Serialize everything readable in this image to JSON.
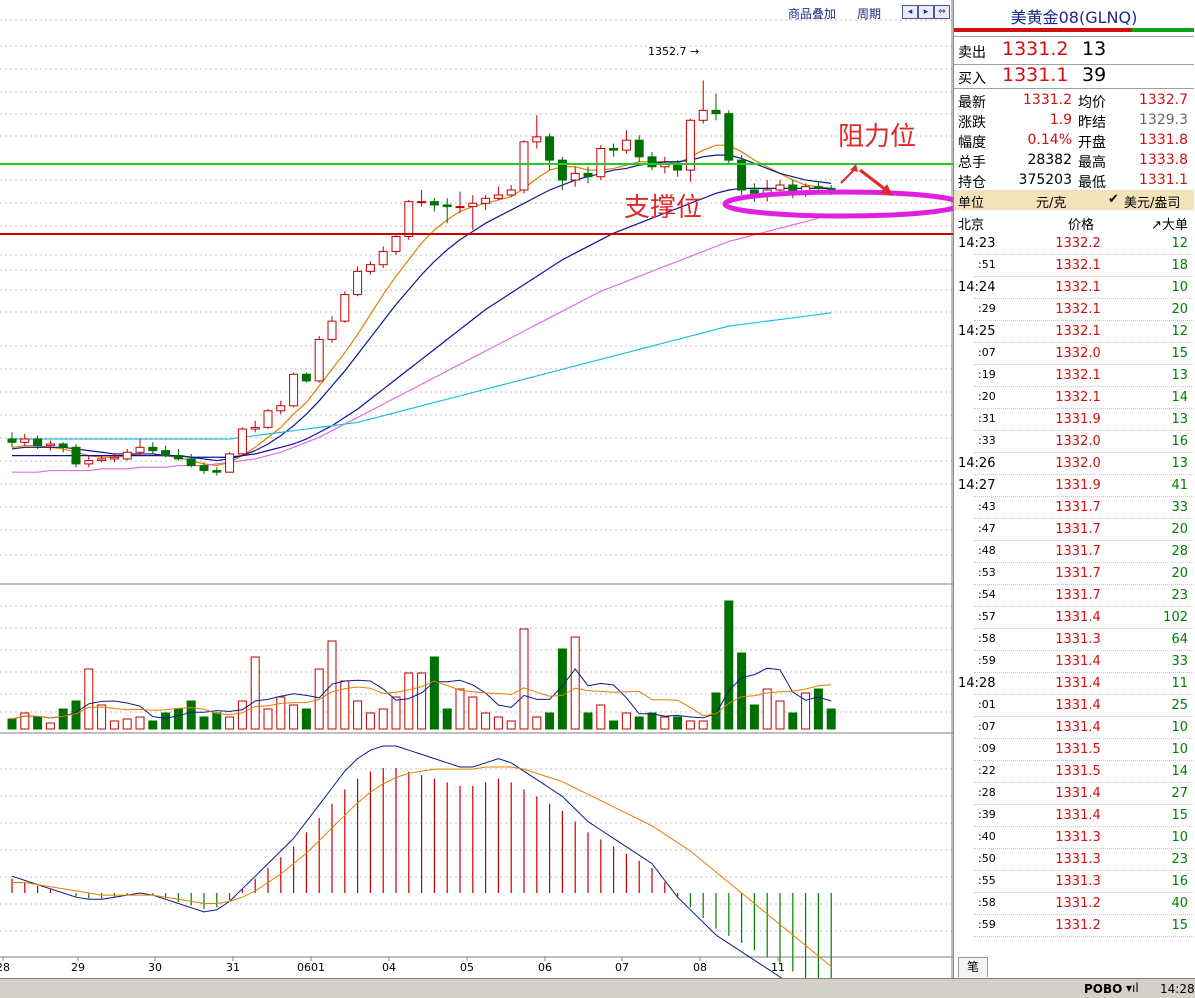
{
  "toolbar": {
    "overlay_label": "商品叠加",
    "period_label": "周期"
  },
  "quote": {
    "title": "美黄金08(GLNQ)",
    "sell_label": "卖出",
    "sell_price": "1331.2",
    "sell_qty": "13",
    "buy_label": "买入",
    "buy_price": "1331.1",
    "buy_qty": "39",
    "stats": [
      {
        "l1": "最新",
        "v1": "1331.2",
        "l2": "均价",
        "v2": "1332.7"
      },
      {
        "l1": "涨跌",
        "v1": "1.9",
        "l2": "昨结",
        "v2": "1329.3"
      },
      {
        "l1": "幅度",
        "v1": "0.14%",
        "l2": "开盘",
        "v2": "1331.8"
      },
      {
        "l1": "总手",
        "v1": "28382",
        "l2": "最高",
        "v2": "1333.8"
      },
      {
        "l1": "持仓",
        "v1": "375203",
        "l2": "最低",
        "v2": "1331.1"
      }
    ],
    "unit_left": "单位",
    "unit_mid": "元/克",
    "unit_right": "美元/盎司",
    "tick_headers": [
      "北京",
      "价格",
      "↗大单"
    ],
    "ticks": [
      {
        "t": "14:23",
        "p": "1332.2",
        "v": "12",
        "major": true
      },
      {
        "t": ":51",
        "p": "1332.1",
        "v": "18"
      },
      {
        "t": "14:24",
        "p": "1332.1",
        "v": "10",
        "major": true
      },
      {
        "t": ":29",
        "p": "1332.1",
        "v": "20"
      },
      {
        "t": "14:25",
        "p": "1332.1",
        "v": "12",
        "major": true
      },
      {
        "t": ":07",
        "p": "1332.0",
        "v": "15"
      },
      {
        "t": ":19",
        "p": "1332.1",
        "v": "13"
      },
      {
        "t": ":20",
        "p": "1332.1",
        "v": "14"
      },
      {
        "t": ":31",
        "p": "1331.9",
        "v": "13"
      },
      {
        "t": ":33",
        "p": "1332.0",
        "v": "16"
      },
      {
        "t": "14:26",
        "p": "1332.0",
        "v": "13",
        "major": true
      },
      {
        "t": "14:27",
        "p": "1331.9",
        "v": "41",
        "major": true
      },
      {
        "t": ":43",
        "p": "1331.7",
        "v": "33"
      },
      {
        "t": ":47",
        "p": "1331.7",
        "v": "20"
      },
      {
        "t": ":48",
        "p": "1331.7",
        "v": "28"
      },
      {
        "t": ":53",
        "p": "1331.7",
        "v": "20"
      },
      {
        "t": ":54",
        "p": "1331.7",
        "v": "23"
      },
      {
        "t": ":57",
        "p": "1331.4",
        "v": "102"
      },
      {
        "t": ":58",
        "p": "1331.3",
        "v": "64"
      },
      {
        "t": ":59",
        "p": "1331.4",
        "v": "33"
      },
      {
        "t": "14:28",
        "p": "1331.4",
        "v": "11",
        "major": true
      },
      {
        "t": ":01",
        "p": "1331.4",
        "v": "25"
      },
      {
        "t": ":07",
        "p": "1331.4",
        "v": "10"
      },
      {
        "t": ":09",
        "p": "1331.5",
        "v": "10"
      },
      {
        "t": ":22",
        "p": "1331.5",
        "v": "14"
      },
      {
        "t": ":28",
        "p": "1331.4",
        "v": "27"
      },
      {
        "t": ":39",
        "p": "1331.4",
        "v": "15"
      },
      {
        "t": ":40",
        "p": "1331.3",
        "v": "10"
      },
      {
        "t": ":50",
        "p": "1331.3",
        "v": "23"
      },
      {
        "t": ":55",
        "p": "1331.3",
        "v": "16"
      },
      {
        "t": ":58",
        "p": "1331.2",
        "v": "40"
      },
      {
        "t": ":59",
        "p": "1331.2",
        "v": "15"
      }
    ],
    "bottom_tab": "笔"
  },
  "statusbar": {
    "brand": "POBO",
    "time": "14:28"
  },
  "annotations": {
    "resistance": "阻力位",
    "support": "支撑位",
    "colors": {
      "resistance_line": "#22cc22",
      "support_line": "#cc0000",
      "ellipse": "#e020e0",
      "arrow": "#e02828"
    }
  },
  "chart_data": {
    "type": "candlestick",
    "title": "",
    "x_tick_labels": [
      "28",
      "29",
      "30",
      "31",
      "0601",
      "04",
      "05",
      "06",
      "07",
      "08",
      "11"
    ],
    "high_label": "1352.7",
    "candles": [
      {
        "o": 50,
        "c": 48,
        "h": 54,
        "l": 45
      },
      {
        "o": 48,
        "c": 50,
        "h": 53,
        "l": 46
      },
      {
        "o": 50,
        "c": 46,
        "h": 52,
        "l": 44
      },
      {
        "o": 46,
        "c": 47,
        "h": 49,
        "l": 43
      },
      {
        "o": 47,
        "c": 45,
        "h": 48,
        "l": 42
      },
      {
        "o": 45,
        "c": 35,
        "h": 47,
        "l": 33
      },
      {
        "o": 35,
        "c": 37,
        "h": 40,
        "l": 33
      },
      {
        "o": 37,
        "c": 38,
        "h": 40,
        "l": 36
      },
      {
        "o": 38,
        "c": 39,
        "h": 41,
        "l": 36
      },
      {
        "o": 38,
        "c": 42,
        "h": 44,
        "l": 37
      },
      {
        "o": 42,
        "c": 45,
        "h": 50,
        "l": 40
      },
      {
        "o": 45,
        "c": 43,
        "h": 48,
        "l": 41
      },
      {
        "o": 43,
        "c": 40,
        "h": 46,
        "l": 39
      },
      {
        "o": 40,
        "c": 38,
        "h": 44,
        "l": 37
      },
      {
        "o": 38,
        "c": 34,
        "h": 41,
        "l": 33
      },
      {
        "o": 34,
        "c": 31,
        "h": 36,
        "l": 29
      },
      {
        "o": 31,
        "c": 30,
        "h": 33,
        "l": 28
      },
      {
        "o": 30,
        "c": 41,
        "h": 42,
        "l": 30
      },
      {
        "o": 41,
        "c": 56,
        "h": 57,
        "l": 40
      },
      {
        "o": 56,
        "c": 57,
        "h": 61,
        "l": 54
      },
      {
        "o": 57,
        "c": 67,
        "h": 68,
        "l": 56
      },
      {
        "o": 67,
        "c": 70,
        "h": 73,
        "l": 65
      },
      {
        "o": 70,
        "c": 89,
        "h": 90,
        "l": 69
      },
      {
        "o": 89,
        "c": 85,
        "h": 90,
        "l": 84
      },
      {
        "o": 85,
        "c": 110,
        "h": 112,
        "l": 84
      },
      {
        "o": 110,
        "c": 121,
        "h": 124,
        "l": 108
      },
      {
        "o": 121,
        "c": 137,
        "h": 139,
        "l": 120
      },
      {
        "o": 137,
        "c": 151,
        "h": 154,
        "l": 136
      },
      {
        "o": 151,
        "c": 155,
        "h": 157,
        "l": 149
      },
      {
        "o": 155,
        "c": 163,
        "h": 166,
        "l": 153
      },
      {
        "o": 163,
        "c": 172,
        "h": 174,
        "l": 161
      },
      {
        "o": 172,
        "c": 193,
        "h": 194,
        "l": 170
      },
      {
        "o": 193,
        "c": 193,
        "h": 200,
        "l": 190
      },
      {
        "o": 193,
        "c": 191,
        "h": 195,
        "l": 187
      },
      {
        "o": 191,
        "c": 190,
        "h": 195,
        "l": 180
      },
      {
        "o": 190,
        "c": 190,
        "h": 199,
        "l": 186
      },
      {
        "o": 190,
        "c": 192,
        "h": 197,
        "l": 176
      },
      {
        "o": 192,
        "c": 195,
        "h": 197,
        "l": 188
      },
      {
        "o": 195,
        "c": 197,
        "h": 202,
        "l": 194
      },
      {
        "o": 197,
        "c": 200,
        "h": 203,
        "l": 196
      },
      {
        "o": 200,
        "c": 229,
        "h": 230,
        "l": 198
      },
      {
        "o": 229,
        "c": 232,
        "h": 245,
        "l": 225
      },
      {
        "o": 232,
        "c": 218,
        "h": 234,
        "l": 212
      },
      {
        "o": 218,
        "c": 206,
        "h": 220,
        "l": 200
      },
      {
        "o": 206,
        "c": 210,
        "h": 214,
        "l": 202
      },
      {
        "o": 210,
        "c": 208,
        "h": 214,
        "l": 204
      },
      {
        "o": 208,
        "c": 225,
        "h": 227,
        "l": 206
      },
      {
        "o": 225,
        "c": 224,
        "h": 228,
        "l": 220
      },
      {
        "o": 224,
        "c": 230,
        "h": 236,
        "l": 222
      },
      {
        "o": 230,
        "c": 220,
        "h": 233,
        "l": 217
      },
      {
        "o": 220,
        "c": 214,
        "h": 223,
        "l": 212
      },
      {
        "o": 214,
        "c": 216,
        "h": 220,
        "l": 210
      },
      {
        "o": 216,
        "c": 212,
        "h": 218,
        "l": 208
      },
      {
        "o": 212,
        "c": 242,
        "h": 243,
        "l": 205
      },
      {
        "o": 242,
        "c": 248,
        "h": 266,
        "l": 240
      },
      {
        "o": 248,
        "c": 246,
        "h": 258,
        "l": 242
      },
      {
        "o": 246,
        "c": 218,
        "h": 248,
        "l": 216
      },
      {
        "o": 218,
        "c": 200,
        "h": 221,
        "l": 197
      },
      {
        "o": 200,
        "c": 198,
        "h": 204,
        "l": 193
      },
      {
        "o": 198,
        "c": 200,
        "h": 206,
        "l": 193
      },
      {
        "o": 200,
        "c": 203,
        "h": 206,
        "l": 197
      },
      {
        "o": 203,
        "c": 198,
        "h": 206,
        "l": 195
      },
      {
        "o": 198,
        "c": 202,
        "h": 204,
        "l": 196
      },
      {
        "o": 202,
        "c": 201,
        "h": 205,
        "l": 199
      },
      {
        "o": 201,
        "c": 199,
        "h": 203,
        "l": 197
      }
    ],
    "ma_series": [
      {
        "color": "#e08000",
        "values": [
          45,
          46,
          46,
          45,
          44,
          42,
          40,
          39,
          39,
          40,
          41,
          41,
          40,
          39,
          37,
          35,
          34,
          36,
          40,
          45,
          51,
          57,
          65,
          72,
          82,
          92,
          102,
          113,
          125,
          137,
          148,
          158,
          168,
          176,
          182,
          187,
          190,
          192,
          194,
          196,
          201,
          207,
          212,
          214,
          214,
          212,
          212,
          213,
          215,
          217,
          217,
          217,
          216,
          220,
          224,
          227,
          227,
          223,
          218,
          214,
          210,
          206,
          203,
          202,
          201
        ]
      },
      {
        "color": "#0a1a8a",
        "values": [
          44,
          45,
          45,
          45,
          45,
          44,
          43,
          42,
          41,
          41,
          41,
          41,
          40,
          40,
          39,
          38,
          37,
          38,
          40,
          43,
          47,
          52,
          58,
          65,
          73,
          82,
          91,
          101,
          111,
          121,
          131,
          140,
          149,
          157,
          164,
          170,
          175,
          180,
          184,
          188,
          192,
          196,
          200,
          203,
          206,
          208,
          210,
          212,
          213,
          215,
          216,
          217,
          217,
          218,
          220,
          221,
          221,
          219,
          216,
          213,
          210,
          208,
          206,
          205,
          204
        ]
      },
      {
        "color": "#1010a0",
        "values": [
          40,
          40,
          40,
          40,
          40,
          40,
          40,
          40,
          40,
          40,
          40,
          40,
          40,
          40,
          39,
          39,
          39,
          39,
          40,
          41,
          43,
          45,
          47,
          50,
          54,
          58,
          63,
          68,
          74,
          80,
          86,
          92,
          98,
          104,
          110,
          116,
          122,
          128,
          133,
          138,
          143,
          148,
          153,
          158,
          162,
          166,
          170,
          174,
          177,
          180,
          183,
          186,
          189,
          192,
          195,
          198,
          200,
          201,
          201,
          201,
          201,
          201,
          201,
          201,
          201
        ]
      },
      {
        "color": "#e070e0",
        "values": [
          30,
          30,
          30,
          31,
          31,
          31,
          31,
          32,
          32,
          32,
          33,
          33,
          33,
          34,
          34,
          34,
          35,
          36,
          37,
          38,
          40,
          42,
          45,
          48,
          51,
          55,
          59,
          63,
          67,
          71,
          75,
          79,
          83,
          87,
          91,
          95,
          99,
          103,
          107,
          111,
          115,
          119,
          123,
          127,
          131,
          135,
          139,
          142,
          145,
          148,
          151,
          154,
          157,
          160,
          163,
          166,
          169,
          171,
          173,
          175,
          177,
          179,
          181,
          183,
          185
        ]
      },
      {
        "color": "#20c0e0",
        "values": [
          50,
          50,
          50,
          50,
          50,
          50,
          50,
          50,
          50,
          50,
          50,
          50,
          50,
          50,
          50,
          50,
          50,
          50,
          51,
          52,
          53,
          54,
          55,
          56,
          57,
          58,
          59,
          60,
          62,
          64,
          66,
          68,
          70,
          72,
          74,
          76,
          78,
          80,
          82,
          84,
          86,
          88,
          90,
          92,
          94,
          96,
          98,
          100,
          102,
          104,
          106,
          108,
          110,
          112,
          114,
          116,
          118,
          119,
          120,
          121,
          122,
          123,
          124,
          125,
          126
        ]
      }
    ],
    "volume": [
      5,
      8,
      6,
      3,
      10,
      14,
      30,
      12,
      4,
      5,
      6,
      4,
      8,
      10,
      14,
      6,
      8,
      6,
      14,
      36,
      10,
      16,
      12,
      10,
      30,
      44,
      24,
      14,
      8,
      10,
      16,
      28,
      28,
      36,
      10,
      20,
      16,
      8,
      6,
      4,
      50,
      6,
      8,
      40,
      46,
      8,
      12,
      4,
      8,
      6,
      8,
      6,
      6,
      4,
      4,
      18,
      64,
      38,
      12,
      20,
      14,
      8,
      18,
      20,
      10
    ],
    "macd_dif": [
      8,
      6,
      4,
      2,
      0,
      -2,
      -3,
      -3,
      -2,
      -1,
      0,
      -1,
      -3,
      -5,
      -7,
      -9,
      -8,
      -4,
      2,
      8,
      14,
      20,
      26,
      34,
      42,
      50,
      58,
      64,
      68,
      70,
      70,
      68,
      66,
      64,
      62,
      60,
      60,
      62,
      64,
      62,
      58,
      54,
      50,
      46,
      40,
      34,
      30,
      26,
      22,
      18,
      14,
      6,
      -2,
      -8,
      -14,
      -20,
      -24,
      -28,
      -32,
      -36,
      -40,
      -44,
      -48,
      -52,
      -55
    ],
    "macd_dea": [
      5,
      5,
      4,
      3,
      2,
      1,
      0,
      -1,
      -1,
      -1,
      -1,
      -1,
      -2,
      -3,
      -4,
      -5,
      -5,
      -4,
      -2,
      1,
      5,
      9,
      14,
      19,
      25,
      31,
      37,
      43,
      48,
      52,
      55,
      57,
      58,
      59,
      59,
      59,
      59,
      60,
      60,
      60,
      59,
      57,
      55,
      53,
      50,
      47,
      44,
      41,
      38,
      35,
      32,
      28,
      24,
      20,
      15,
      10,
      5,
      0,
      -5,
      -10,
      -15,
      -20,
      -25,
      -30,
      -35
    ],
    "legend": []
  }
}
